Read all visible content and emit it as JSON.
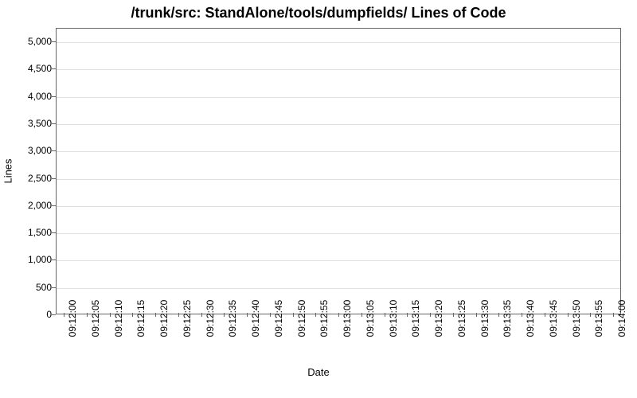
{
  "chart_data": {
    "type": "line",
    "title": "/trunk/src: StandAlone/tools/dumpfields/ Lines of Code",
    "xlabel": "Date",
    "ylabel": "Lines",
    "ylim": [
      0,
      5250
    ],
    "y_ticks": [
      0,
      500,
      1000,
      1500,
      2000,
      2500,
      3000,
      3500,
      4000,
      4500,
      5000
    ],
    "y_tick_labels": [
      "0",
      "500",
      "1,000",
      "1,500",
      "2,000",
      "2,500",
      "3,000",
      "3,500",
      "4,000",
      "4,500",
      "5,000"
    ],
    "x_ticks": [
      "09:12:00",
      "09:12:05",
      "09:12:10",
      "09:12:15",
      "09:12:20",
      "09:12:25",
      "09:12:30",
      "09:12:35",
      "09:12:40",
      "09:12:45",
      "09:12:50",
      "09:12:55",
      "09:13:00",
      "09:13:05",
      "09:13:10",
      "09:13:15",
      "09:13:20",
      "09:13:25",
      "09:13:30",
      "09:13:35",
      "09:13:40",
      "09:13:45",
      "09:13:50",
      "09:13:55",
      "09:14:00"
    ],
    "series": []
  }
}
